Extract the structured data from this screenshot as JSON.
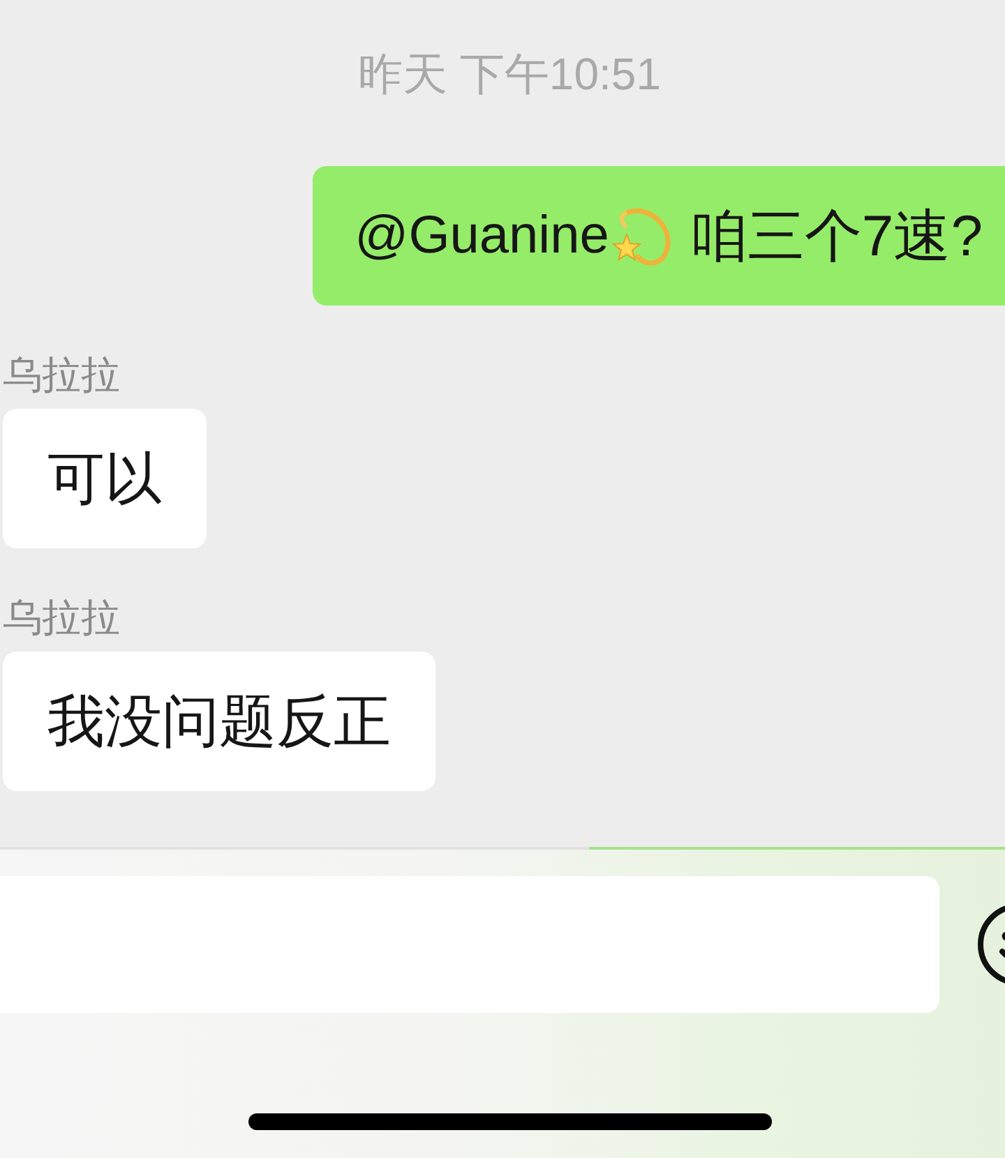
{
  "timestamp": "昨天 下午10:51",
  "messages": [
    {
      "kind": "outgoing",
      "parts": [
        {
          "kind": "mention",
          "text": "@Guanine"
        },
        {
          "kind": "emoji"
        },
        {
          "kind": "text",
          "text": "咱三个7速?"
        }
      ]
    },
    {
      "kind": "incoming",
      "sender": "乌拉拉",
      "parts": [
        {
          "kind": "text",
          "text": "可以"
        }
      ]
    },
    {
      "kind": "incoming",
      "sender": "乌拉拉",
      "parts": [
        {
          "kind": "text",
          "text": "我没问题反正"
        }
      ]
    }
  ]
}
